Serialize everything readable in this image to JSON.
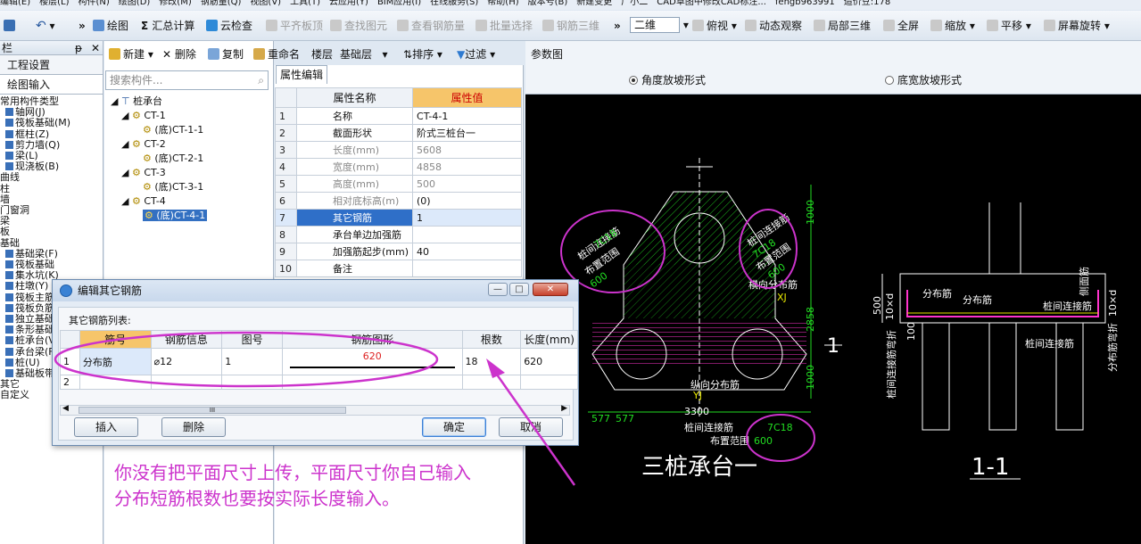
{
  "menubar": [
    "编辑(E)",
    "楼层(L)",
    "构件(N)",
    "绘图(D)",
    "修改(M)",
    "钢筋量(Q)",
    "视图(V)",
    "工具(T)",
    "云应用(Y)",
    "BIM应用(I)",
    "在线服务(S)",
    "帮助(H)",
    "版本号(B)",
    "新建变更",
    "广小二",
    "CAD草图中修改CAD标注...",
    "fengb963991",
    "造价豆:178"
  ],
  "toolbar": {
    "draw": "绘图",
    "calc": "汇总计算",
    "cloud_check": "云检查",
    "align_top": "平齐板顶",
    "find_elem": "查找图元",
    "view_rebar": "查看钢筋量",
    "batch_select": "批量选择",
    "rebar_3d": "钢筋三维",
    "view_mode": "二维",
    "top_view": "俯视",
    "dynamic_view": "动态观察",
    "local_3d": "局部三维",
    "fullscreen": "全屏",
    "zoom": "缩放",
    "pan": "平移",
    "rotate": "屏幕旋转",
    "new": "新建",
    "delete": "删除",
    "copy": "复制",
    "rename": "重命名",
    "floor_label": "楼层",
    "floor_value": "基础层",
    "sort": "排序",
    "filter": "过滤"
  },
  "left_panel": {
    "header": "栏",
    "pin": "ᵽ",
    "close": "✕",
    "settings": "工程设置",
    "draw_input": "绘图输入",
    "items": [
      "常用构件类型",
      "轴网(J)",
      "筏板基础(M)",
      "框柱(Z)",
      "剪力墙(Q)",
      "梁(L)",
      "现浇板(B)",
      "曲线",
      "柱",
      "墙",
      "门窗洞",
      "梁",
      "板",
      "基础",
      "基础梁(F)",
      "筏板基础",
      "集水坑(K)",
      "柱墩(Y)",
      "筏板主筋",
      "筏板负筋",
      "独立基础",
      "条形基础",
      "桩承台(V)",
      "承台梁(F)",
      "桩(U)",
      "基础板带(W)",
      "其它",
      "自定义"
    ]
  },
  "middle_panel": {
    "search_placeholder": "搜索构件...",
    "tree_root": "桩承台",
    "tree": [
      {
        "name": "CT-1",
        "child": "(底)CT-1-1"
      },
      {
        "name": "CT-2",
        "child": "(底)CT-2-1"
      },
      {
        "name": "CT-3",
        "child": "(底)CT-3-1"
      },
      {
        "name": "CT-4",
        "child": "(底)CT-4-1"
      }
    ]
  },
  "property_panel": {
    "tab": "属性编辑",
    "col_name": "属性名称",
    "col_value": "属性值",
    "rows": [
      {
        "no": "1",
        "name": "名称",
        "value": "CT-4-1"
      },
      {
        "no": "2",
        "name": "截面形状",
        "value": "阶式三桩台一"
      },
      {
        "no": "3",
        "name": "长度(mm)",
        "value": "5608"
      },
      {
        "no": "4",
        "name": "宽度(mm)",
        "value": "4858"
      },
      {
        "no": "5",
        "name": "高度(mm)",
        "value": "500"
      },
      {
        "no": "6",
        "name": "相对底标高(m)",
        "value": "(0)"
      },
      {
        "no": "7",
        "name": "其它钢筋",
        "value": "1"
      },
      {
        "no": "8",
        "name": "承台单边加强筋",
        "value": ""
      },
      {
        "no": "9",
        "name": "加强筋起步(mm)",
        "value": "40"
      },
      {
        "no": "10",
        "name": "备注",
        "value": ""
      }
    ]
  },
  "cad_panel": {
    "title": "参数图",
    "option_angle": "角度放坡形式",
    "option_width": "底宽放坡形式",
    "labels": {
      "pile_conn": "桩间连接筋",
      "rebar_7c18": "7C18",
      "layout_range": "布置范围",
      "val_600": "600",
      "transverse": "横向分布筋",
      "xj": "XJ",
      "longitudinal": "纵向分布筋",
      "yj": "YJ",
      "dim_2858": "2858",
      "dim_1000": "1000",
      "dim_577": "577",
      "dim_3300": "3300",
      "section_1": "1",
      "plan_title": "三桩承台一",
      "section_title": "1-1",
      "dist_bar": "分布筋",
      "side_bar": "侧面筋",
      "dim_500": "500",
      "dim_10d": "10×d",
      "dim_100": "100",
      "anchor_bend": "桩间连接筋弯折",
      "dist_bend": "分布筋弯折"
    }
  },
  "dialog": {
    "title": "编辑其它钢筋",
    "list_label": "其它钢筋列表:",
    "columns": [
      "筋号",
      "钢筋信息",
      "图号",
      "钢筋图形",
      "根数",
      "长度(mm)"
    ],
    "row1": {
      "no": "1",
      "name": "分布筋",
      "info": "⌀12",
      "fig": "1",
      "shape_len": "620",
      "count": "18",
      "length": "620"
    },
    "row2_no": "2",
    "btn_insert": "插入",
    "btn_delete": "删除",
    "btn_ok": "确定",
    "btn_cancel": "取消",
    "scroll_mid": "III"
  },
  "annotation": {
    "line1": "你没有把平面尺寸上传，平面尺寸你自己输入",
    "line2": "分布短筋根数也要按实际长度输入。"
  },
  "colors": {
    "magenta": "#cc33cc",
    "cad_green": "#22dd22",
    "cad_yellow": "#e8e800",
    "cad_white": "#ffffff"
  }
}
